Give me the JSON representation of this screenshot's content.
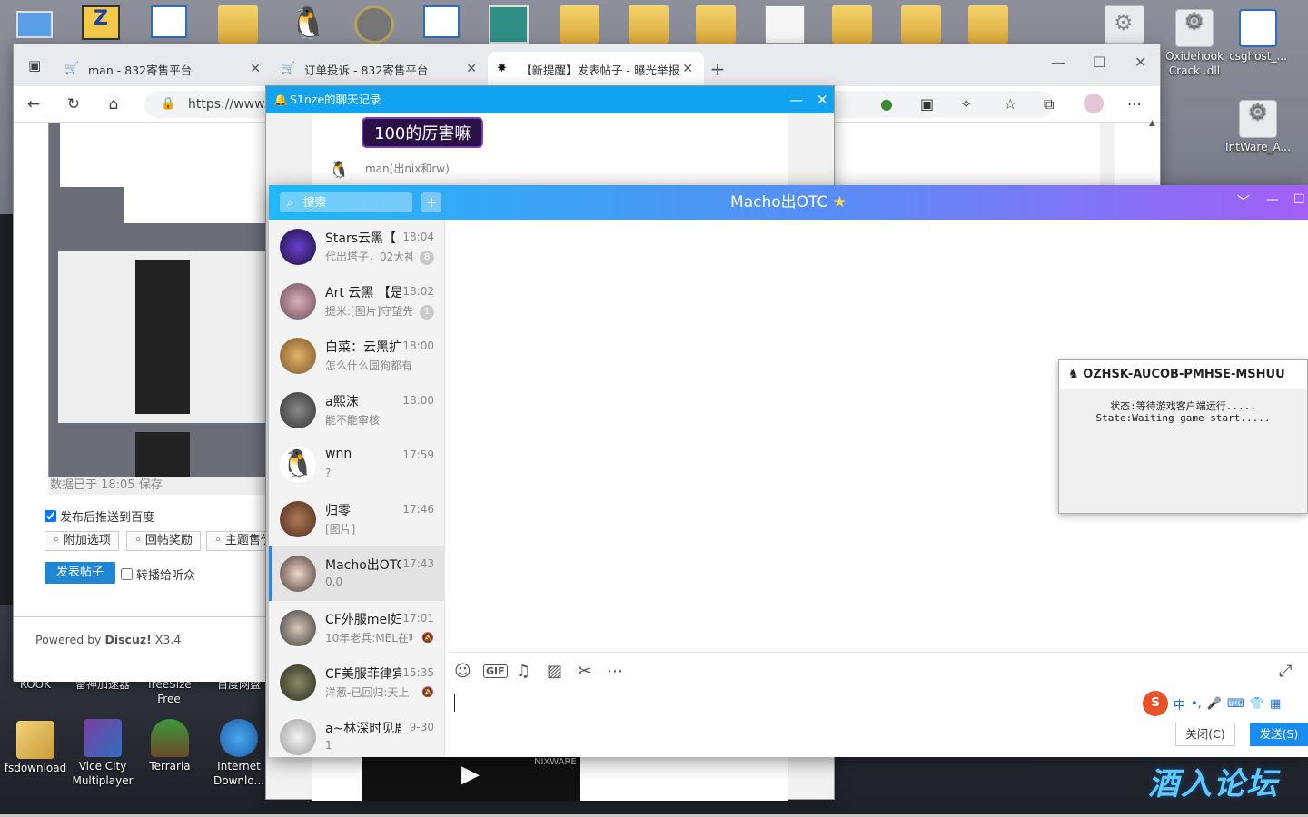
{
  "desktop": {
    "right_icons": [
      {
        "label": "Oxidehook Crack .dll",
        "icon": "gear-file-icon"
      },
      {
        "label": "csghost_...",
        "icon": "window-icon"
      },
      {
        "label": "IntWare_A...",
        "icon": "gear-file-icon"
      }
    ],
    "bottom_labels": [
      "KOOK",
      "雷神加速器",
      "TreeSize Free",
      "百度网盘"
    ],
    "bottom_icons": [
      {
        "label": "fsdownload",
        "icon": "archive-icon"
      },
      {
        "label": "Vice City Multiplayer",
        "icon": "vcmp-icon"
      },
      {
        "label": "Terraria",
        "icon": "tree-icon"
      },
      {
        "label": "Internet Downlo...",
        "icon": "globe-download-icon"
      }
    ],
    "watermark": "酒入论坛"
  },
  "browser": {
    "tabs": [
      {
        "label": "man - 832寄售平台",
        "active": false
      },
      {
        "label": "订单投诉 - 832寄售平台",
        "active": false
      },
      {
        "label": "【新提醒】发表帖子 - 曝光举报",
        "active": true
      }
    ],
    "url": "https://www.ju",
    "page": {
      "saved_text": "数据已于 18:05 保存",
      "push_baidu": "发布后推送到百度",
      "options": [
        "附加选项",
        "回帖奖励",
        "主题售价"
      ],
      "post_button": "发表帖子",
      "broadcast": "转播给听众",
      "powered_prefix": "Powered by ",
      "powered_brand": "Discuz!",
      "powered_version": " X3.4"
    }
  },
  "chat_history": {
    "title": "S1nze的聊天记录",
    "message": "100的厉害嘛",
    "sender": "man(出nix和rw)",
    "thumbnail_text": "NIXWARE"
  },
  "qq": {
    "title": "Macho出OTC",
    "search_placeholder": "搜索",
    "conversations": [
      {
        "name": "Stars云黑【",
        "time": "18:04",
        "preview": "代出塔子，02大神",
        "badge": "8"
      },
      {
        "name": "Art 云黑 【是",
        "time": "18:02",
        "preview": "提米:[图片]守望先锋",
        "badge": "1"
      },
      {
        "name": "白菜：云黑扩",
        "time": "18:00",
        "preview": "怎么什么圆狗都有",
        "badge": ""
      },
      {
        "name": "a熙沫",
        "time": "18:00",
        "preview": "能不能审核",
        "badge": ""
      },
      {
        "name": "wnn",
        "time": "17:59",
        "preview": "?",
        "badge": ""
      },
      {
        "name": "归零",
        "time": "17:46",
        "preview": "[图片]",
        "badge": ""
      },
      {
        "name": "Macho出OTC",
        "time": "17:43",
        "preview": "0.0",
        "badge": ""
      },
      {
        "name": "CF外服mel妇",
        "time": "17:01",
        "preview": "10年老兵:MEL在吗",
        "badge": ""
      },
      {
        "name": "CF美服菲律宾",
        "time": "15:35",
        "preview": "洋葱-已回归:天上",
        "badge": ""
      },
      {
        "name": "a~林深时见鹿",
        "time": "9-30",
        "preview": "1",
        "badge": ""
      }
    ],
    "ime": {
      "brand": "S",
      "mode": "中"
    },
    "close_button": "关闭(C)",
    "send_button": "发送(S)"
  },
  "game_popup": {
    "title": "OZHSK-AUCOB-PMHSE-MSHUU",
    "line1": "状态:等待游戏客户端运行.....",
    "line2": "State:Waiting game start....."
  }
}
